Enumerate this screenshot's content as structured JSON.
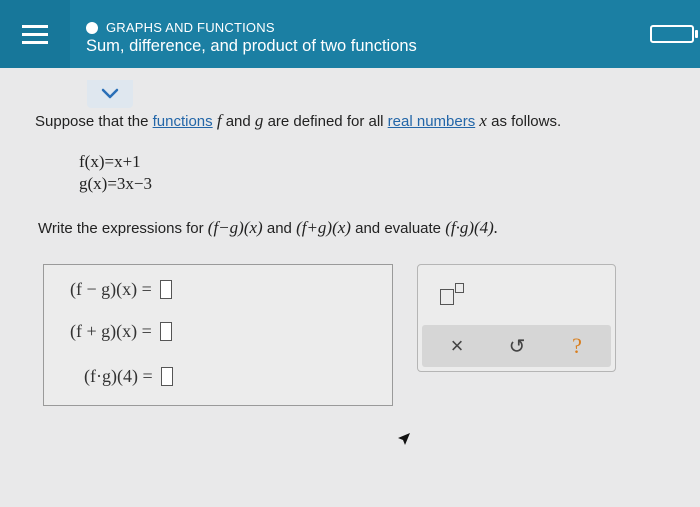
{
  "header": {
    "topic": "GRAPHS AND FUNCTIONS",
    "title": "Sum, difference, and product of two functions"
  },
  "problem": {
    "text_1": "Suppose that the ",
    "link_functions": "functions",
    "f": "f",
    "text_2": " and ",
    "g": "g",
    "text_3": " are defined for all ",
    "link_real_numbers": "real numbers",
    "x": "x",
    "text_4": " as follows."
  },
  "definitions": {
    "f_def": "f(x)=x+1",
    "g_def": "g(x)=3x−3"
  },
  "instruction": {
    "text_1": "Write the expressions for ",
    "expr_1": "(f−g)(x)",
    "text_2": " and ",
    "expr_2": "(f+g)(x)",
    "text_3": " and evaluate ",
    "expr_3": "(f·g)(4).",
    "text_4": ""
  },
  "answers": [
    {
      "label": "(f − g)(x) ="
    },
    {
      "label": "(f + g)(x) ="
    },
    {
      "label": "(f·g)(4) ="
    }
  ],
  "tools": {
    "clear": "×",
    "undo": "↺",
    "help": "?"
  },
  "colors": {
    "header_bg": "#1b7fa3",
    "link": "#2366a8",
    "help_orange": "#d97d1b"
  }
}
